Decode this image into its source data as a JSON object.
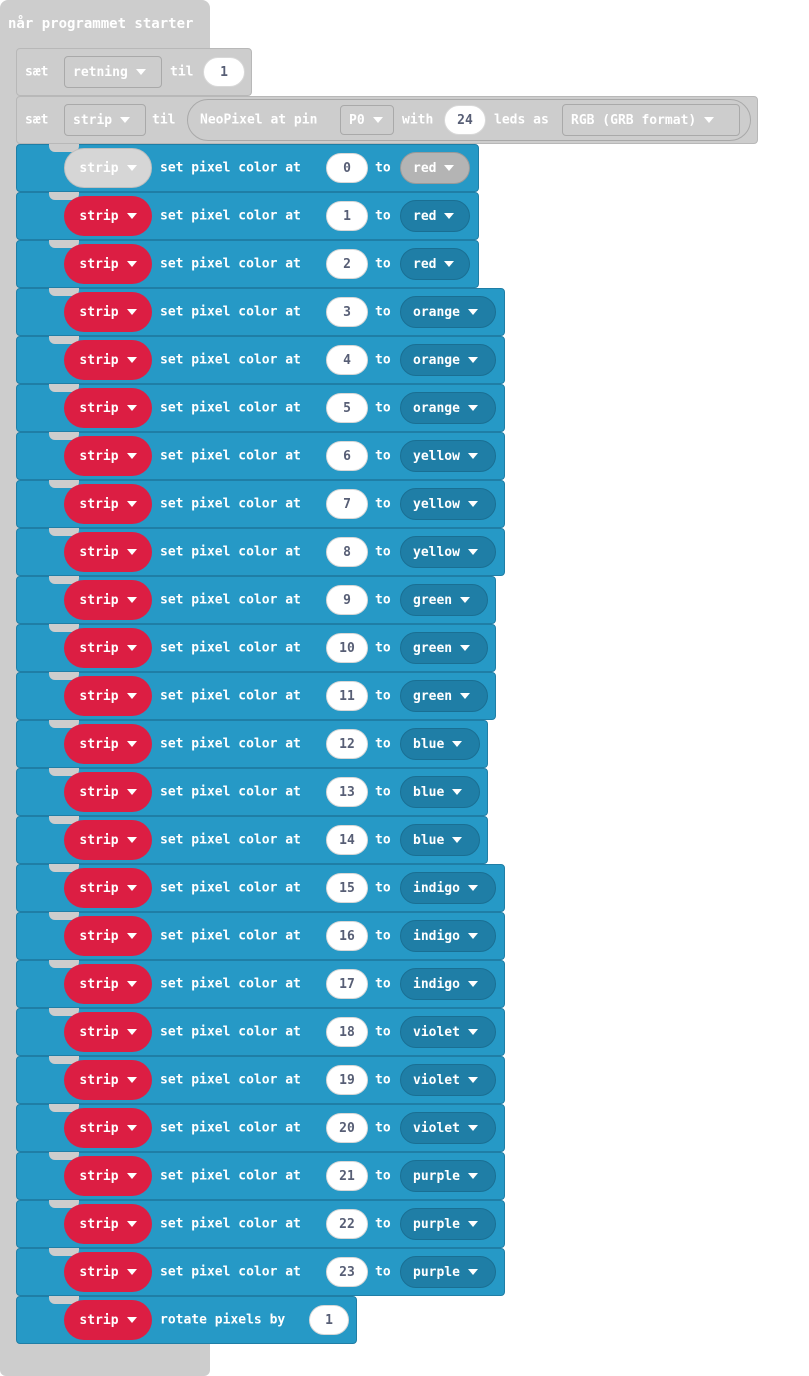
{
  "hat": {
    "title": "når programmet starter"
  },
  "set1": {
    "keyword": "sæt",
    "variable": "retning",
    "til": "til",
    "value": "1"
  },
  "set2": {
    "keyword": "sæt",
    "variable": "strip",
    "til": "til",
    "neopixel": {
      "label1": "NeoPixel at pin",
      "pin": "P0",
      "label2": "with",
      "count": "24",
      "label3": "leds as",
      "mode": "RGB (GRB format)"
    }
  },
  "blocks": {
    "strip_label": "strip",
    "action": "set pixel color at",
    "to": "to",
    "rows": [
      {
        "index": "0",
        "color": "red"
      },
      {
        "index": "1",
        "color": "red"
      },
      {
        "index": "2",
        "color": "red"
      },
      {
        "index": "3",
        "color": "orange"
      },
      {
        "index": "4",
        "color": "orange"
      },
      {
        "index": "5",
        "color": "orange"
      },
      {
        "index": "6",
        "color": "yellow"
      },
      {
        "index": "7",
        "color": "yellow"
      },
      {
        "index": "8",
        "color": "yellow"
      },
      {
        "index": "9",
        "color": "green"
      },
      {
        "index": "10",
        "color": "green"
      },
      {
        "index": "11",
        "color": "green"
      },
      {
        "index": "12",
        "color": "blue"
      },
      {
        "index": "13",
        "color": "blue"
      },
      {
        "index": "14",
        "color": "blue"
      },
      {
        "index": "15",
        "color": "indigo"
      },
      {
        "index": "16",
        "color": "indigo"
      },
      {
        "index": "17",
        "color": "indigo"
      },
      {
        "index": "18",
        "color": "violet"
      },
      {
        "index": "19",
        "color": "violet"
      },
      {
        "index": "20",
        "color": "violet"
      },
      {
        "index": "21",
        "color": "purple"
      },
      {
        "index": "22",
        "color": "purple"
      },
      {
        "index": "23",
        "color": "purple"
      }
    ]
  },
  "rotate": {
    "strip": "strip",
    "label": "rotate pixels by",
    "value": "1"
  }
}
